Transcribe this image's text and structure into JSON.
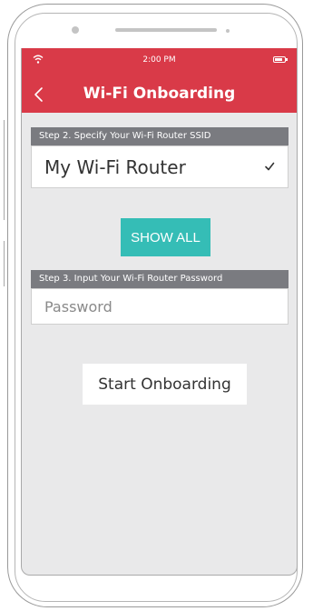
{
  "status_bar": {
    "time": "2:00 PM",
    "wifi_icon": "wifi-icon",
    "battery_icon": "battery-icon"
  },
  "nav": {
    "title": "Wi-Fi Onboarding",
    "back_icon": "chevron-left-icon"
  },
  "step2": {
    "header": "Step 2. Specify Your Wi-Fi Router SSID",
    "ssid_value": "My Wi-Fi Router",
    "check_icon": "checkmark-icon"
  },
  "show_all_label": "SHOW ALL",
  "step3": {
    "header": "Step 3. Input Your Wi-Fi Router Password",
    "password_placeholder": "Password"
  },
  "start_label": "Start Onboarding",
  "colors": {
    "brand_red": "#d93a48",
    "teal_button": "#35bdb6",
    "step_header_gray": "#7a7b80",
    "screen_background": "#e9e9ea"
  }
}
